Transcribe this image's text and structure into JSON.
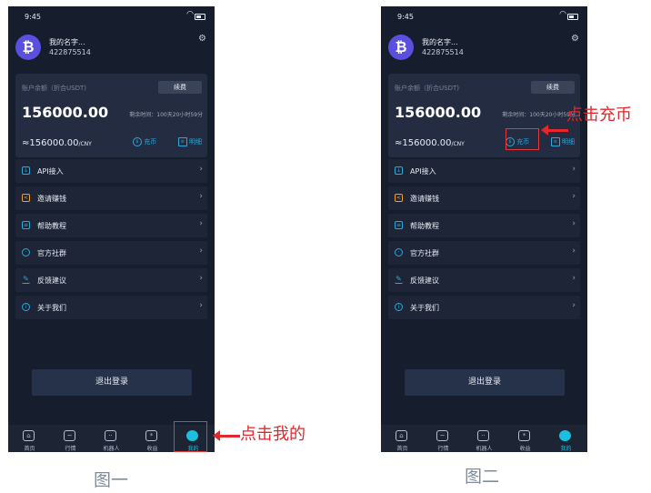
{
  "status": {
    "time": "9:45"
  },
  "profile": {
    "name": "我的名字...",
    "uid": "422875514",
    "avatar_glyph": "₿"
  },
  "balance": {
    "label": "账户余额（折合USDT)",
    "renew_label": "续费",
    "amount": "156000.00",
    "remaining_time": "剩余时间：100天20小时59分",
    "cny_amount": "≈156000.00",
    "cny_unit": "/CNY",
    "recharge_label": "充币",
    "detail_label": "明细"
  },
  "menu": {
    "items": [
      {
        "label": "API接入",
        "icon": "download-icon"
      },
      {
        "label": "邀请赚钱",
        "icon": "share-icon"
      },
      {
        "label": "帮助教程",
        "icon": "book-icon"
      },
      {
        "label": "官方社群",
        "icon": "headset-icon"
      },
      {
        "label": "反馈建议",
        "icon": "pen-icon"
      },
      {
        "label": "关于我们",
        "icon": "info-icon"
      }
    ]
  },
  "logout_label": "退出登录",
  "tabs": [
    {
      "label": "首页",
      "icon": "home-icon"
    },
    {
      "label": "行情",
      "icon": "chart-icon"
    },
    {
      "label": "机器人",
      "icon": "robot-icon"
    },
    {
      "label": "收益",
      "icon": "earnings-icon"
    },
    {
      "label": "我的",
      "icon": "profile-icon",
      "active": true
    }
  ],
  "annotations": {
    "click_mine": "点击我的",
    "click_recharge": "点击充币"
  },
  "captions": {
    "figure1": "图一",
    "figure2": "图二"
  },
  "colors": {
    "background": "#161d2c",
    "card": "#232c40",
    "accent": "#1ac0e0",
    "link": "#2fa8d8",
    "annotation": "#e5262d",
    "avatar": "#5b4fe0"
  }
}
